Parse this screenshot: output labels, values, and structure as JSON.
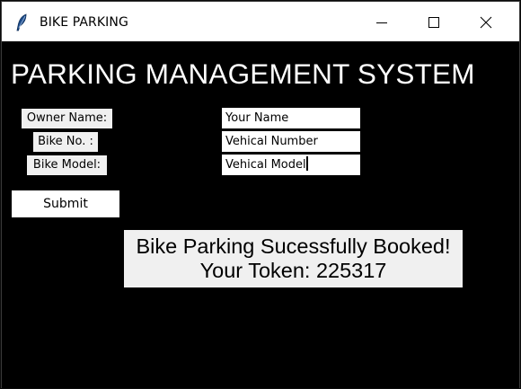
{
  "window": {
    "title": "BIKE PARKING",
    "app_icon": "feather-icon",
    "controls": [
      "minimize-icon",
      "maximize-icon",
      "close-icon"
    ]
  },
  "main": {
    "heading": "PARKING MANAGEMENT SYSTEM",
    "fields": [
      {
        "label": "Owner Name:",
        "value": "Your Name"
      },
      {
        "label": "Bike No. :",
        "value": "Vehical Number"
      },
      {
        "label": "Bike Model:",
        "value": "Vehical Model"
      }
    ],
    "submit_label": "Submit",
    "result": {
      "line1": "Bike Parking Sucessfully Booked!",
      "line2": "Your Token: 225317"
    }
  },
  "colors": {
    "background": "#000000",
    "titlebar": "#ffffff",
    "label_bg": "#f0f0f0",
    "text": "#000000",
    "heading": "#ffffff"
  }
}
